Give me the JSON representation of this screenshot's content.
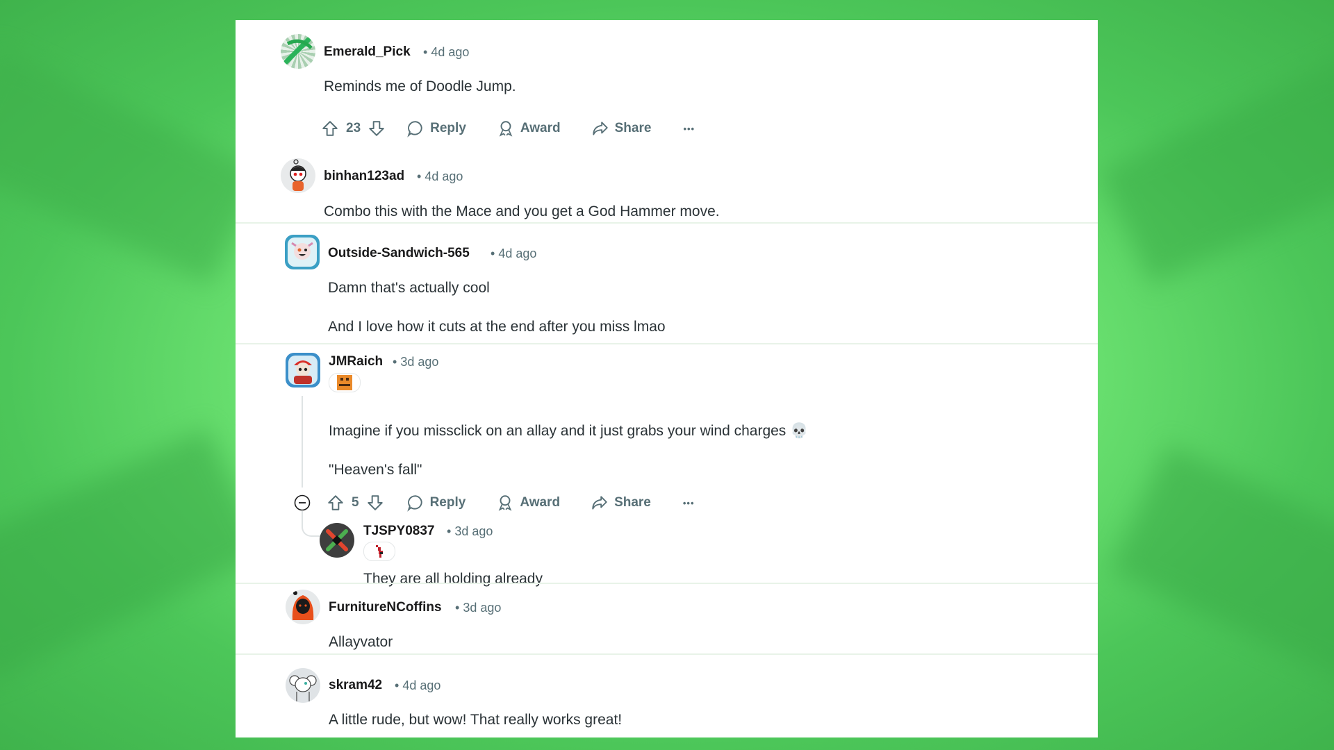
{
  "comments": [
    {
      "username": "Emerald_Pick",
      "time": "4d ago",
      "body": [
        "Reminds me of Doodle Jump."
      ],
      "votes": "23",
      "actions": {
        "reply": "Reply",
        "award": "Award",
        "share": "Share",
        "more": "•••"
      }
    },
    {
      "username": "binhan123ad",
      "time": "4d ago",
      "body": [
        "Combo this with the Mace and you get a God Hammer move."
      ]
    },
    {
      "username": "Outside-Sandwich-565",
      "time": "4d ago",
      "body": [
        "Damn that's actually cool",
        "And I love how it cuts at the end after you miss lmao"
      ]
    },
    {
      "username": "JMRaich",
      "time": "3d ago",
      "body": [
        "Imagine if you missclick on an allay and it just grabs your wind charges 💀",
        "\"Heaven's fall\""
      ],
      "votes": "5",
      "actions": {
        "reply": "Reply",
        "award": "Award",
        "share": "Share",
        "more": "•••"
      },
      "collapse_icon": "collapse-minus-icon",
      "replies": [
        {
          "username": "TJSPY0837",
          "time": "3d ago",
          "body": [
            "They are all holding already"
          ]
        }
      ]
    },
    {
      "username": "FurnitureNCoffins",
      "time": "3d ago",
      "body": [
        "Allayvator"
      ]
    },
    {
      "username": "skram42",
      "time": "4d ago",
      "body": [
        "A little rude, but wow! That really works great!"
      ]
    }
  ],
  "separator": "•",
  "colors": {
    "background_green": "#6ee473",
    "panel": "#ffffff",
    "username": "#1a1a1b",
    "meta": "#576f76",
    "body": "#2a3236"
  }
}
